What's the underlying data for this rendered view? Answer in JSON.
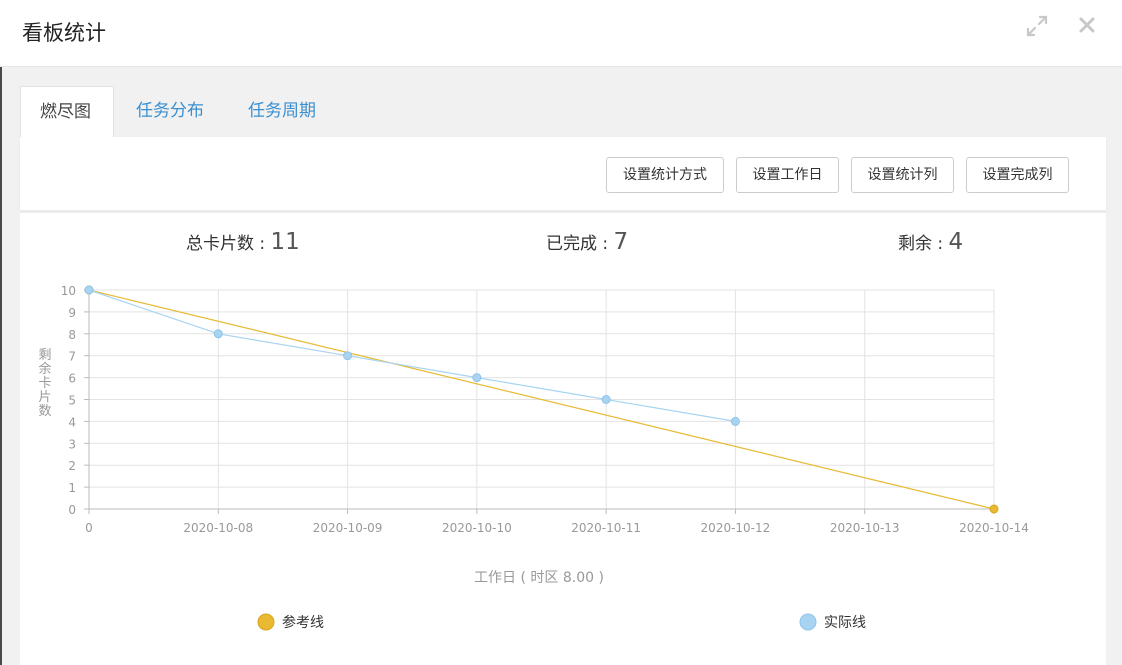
{
  "dialog": {
    "title": "看板统计"
  },
  "tabs": [
    {
      "label": "燃尽图"
    },
    {
      "label": "任务分布"
    },
    {
      "label": "任务周期"
    }
  ],
  "toolbar": {
    "buttons": [
      {
        "label": "设置统计方式"
      },
      {
        "label": "设置工作日"
      },
      {
        "label": "设置统计列"
      },
      {
        "label": "设置完成列"
      }
    ]
  },
  "stats": {
    "total_label": "总卡片数 :",
    "total_value": "11",
    "done_label": "已完成 :",
    "done_value": "7",
    "remaining_label": "剩余 :",
    "remaining_value": "4"
  },
  "colors": {
    "reference": "#e8b931",
    "actual": "#a8d4f2",
    "tab_link": "#3a8fd0"
  },
  "chart_data": {
    "type": "line",
    "categories": [
      "0",
      "2020-10-08",
      "2020-10-09",
      "2020-10-10",
      "2020-10-11",
      "2020-10-12",
      "2020-10-13",
      "2020-10-14"
    ],
    "ylim": [
      0,
      10
    ],
    "yticks": [
      "0",
      "1",
      "2",
      "3",
      "4",
      "5",
      "6",
      "7",
      "8",
      "9",
      "10"
    ],
    "ylabel": "剩余卡片数",
    "xlabel": "工作日 ( 时区 8.00 )",
    "grid": true,
    "legend_position": "bottom",
    "series": [
      {
        "name": "参考线",
        "color": "#e8b931",
        "values": [
          10,
          null,
          null,
          null,
          null,
          null,
          null,
          0
        ]
      },
      {
        "name": "实际线",
        "color": "#a8d4f2",
        "values": [
          10,
          8,
          7,
          6,
          5,
          4,
          null,
          null
        ]
      }
    ]
  }
}
